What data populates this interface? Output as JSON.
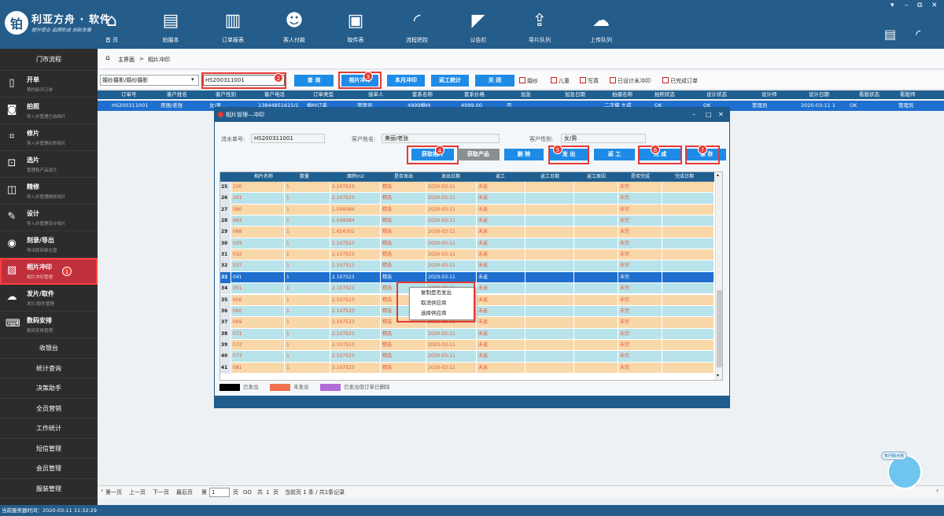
{
  "app": {
    "logo_glyph": "铂",
    "title": "利亚方舟 · 软件",
    "subtitle": "提升营业 品牌形成 创新发展",
    "server_time": "当前服务器时间：2020-03-11 11:32:29"
  },
  "nav": [
    {
      "label": "首 页",
      "icon": "home-icon"
    },
    {
      "label": "拍摄本",
      "icon": "book-icon"
    },
    {
      "label": "订单报表",
      "icon": "bar-chart-icon"
    },
    {
      "label": "客人付款",
      "icon": "users-icon"
    },
    {
      "label": "取件表",
      "icon": "clipboard-icon"
    },
    {
      "label": "流程把控",
      "icon": "signal-icon"
    },
    {
      "label": "公告栏",
      "icon": "megaphone-icon"
    },
    {
      "label": "导片队列",
      "icon": "upload-box-icon"
    },
    {
      "label": "上传队列",
      "icon": "cloud-upload-icon"
    }
  ],
  "sidebar": {
    "header": "门市流程",
    "items": [
      {
        "title": "开单",
        "sub": "预约新开订单",
        "icon": "document-icon"
      },
      {
        "title": "拍照",
        "sub": "导入并管理已拍相片",
        "icon": "camera-icon"
      },
      {
        "title": "修片",
        "sub": "导入并管理初修相片",
        "icon": "crop-icon"
      },
      {
        "title": "选片",
        "sub": "管理和产品选片",
        "icon": "select-icon"
      },
      {
        "title": "精修",
        "sub": "导入并管理精修相片",
        "icon": "retouch-icon"
      },
      {
        "title": "设计",
        "sub": "导入并管理设计相片",
        "icon": "brush-icon"
      },
      {
        "title": "刻录/导出",
        "sub": "导出和刻录光盘",
        "icon": "disc-icon"
      },
      {
        "title": "相片冲印",
        "sub": "相片冲印管理",
        "icon": "photo-icon"
      },
      {
        "title": "发片/取件",
        "sub": "发片/取件管理",
        "icon": "cloud-icon"
      },
      {
        "title": "数码安排",
        "sub": "数码安排管理",
        "icon": "keyboard-icon"
      }
    ],
    "simple": [
      "收银台",
      "统计查询",
      "决策助手",
      "全员营销",
      "工作统计",
      "短信管理",
      "会员管理",
      "服装管理"
    ]
  },
  "breadcrumb": {
    "home": "主界面",
    "sep": ">",
    "current": "相片冲印"
  },
  "toolbar": {
    "filter_value": "婚纱摄影/婚纱摄影",
    "search_value": "HS200311001",
    "query": "查 询",
    "photo_print": "相片冲印",
    "month_print": "本月冲印",
    "rework_stat": "返工统计",
    "close": "关 闭",
    "checks": [
      "婚纱",
      "儿童",
      "写真",
      "已设计未冲印",
      "已完成订单"
    ]
  },
  "badges": [
    "1",
    "2",
    "3",
    "4",
    "5",
    "6",
    "7"
  ],
  "main_table": {
    "headers": [
      "订单号",
      "客户姓名",
      "客户性别",
      "客户电话",
      "订单类型",
      "接单人",
      "套系名称",
      "套系价格",
      "加急",
      "加急日期",
      "拍摄名称",
      "拍照状态",
      "设计状态",
      "设计师",
      "设计日期",
      "看版状态",
      "看版师"
    ],
    "row": [
      "HS200311001",
      "美丽/老张",
      "女/男",
      "13844851615/1",
      "婚纱订单",
      "管理员",
      "4999婚纱",
      "4999.00",
      "否",
      "",
      "二次摄 大成",
      "OK",
      "OK",
      "管理员",
      "2020-03-11 1",
      "OK",
      "管理员"
    ]
  },
  "pager": {
    "first": "第一页",
    "prev": "上一页",
    "next": "下一页",
    "last": "最后页",
    "page_pre": "第",
    "page_value": "1",
    "page_mid": "页",
    "go": "GO",
    "total_pre": "共",
    "total_pages": "1",
    "total_suf": "页",
    "info": "当前页 1 条 / 共1条记录"
  },
  "dialog": {
    "title": "相片管理—冲印",
    "serial_label": "流水单号:",
    "serial_value": "HS200311001",
    "name_label": "客户姓名:",
    "name_value": "美丽/老张",
    "gender_label": "客户性别:",
    "gender_value": "女/男",
    "buttons": {
      "get_photos": "获取相片",
      "get_products": "获取产品",
      "delete": "删 除",
      "send": "发 出",
      "rework": "返 工",
      "complete": "完 成",
      "save": "保 存"
    },
    "grid_headers": [
      "相片名称",
      "数量",
      "面积m2",
      "是否发出",
      "发出日期",
      "返工",
      "返工日期",
      "返工原因",
      "是否完成",
      "完成日期"
    ],
    "rows": [
      {
        "idx": "25",
        "name": "100",
        "qty": "1",
        "area": "2.107523",
        "sent": "精选",
        "date": "2020-03-11",
        "rework": "未返",
        "done": "未完"
      },
      {
        "idx": "26",
        "name": "101",
        "qty": "1",
        "area": "2.107523",
        "sent": "精选",
        "date": "2020-03-11",
        "rework": "未返",
        "done": "未完"
      },
      {
        "idx": "27",
        "name": "080",
        "qty": "1",
        "area": "1.549384",
        "sent": "精选",
        "date": "2020-03-11",
        "rework": "未返",
        "done": "未完"
      },
      {
        "idx": "28",
        "name": "063",
        "qty": "1",
        "area": "1.549384",
        "sent": "精选",
        "date": "2020-03-11",
        "rework": "未返",
        "done": "未完"
      },
      {
        "idx": "29",
        "name": "068",
        "qty": "1",
        "area": "1.654302",
        "sent": "精选",
        "date": "2020-03-11",
        "rework": "未返",
        "done": "未完"
      },
      {
        "idx": "30",
        "name": "029",
        "qty": "1",
        "area": "2.107523",
        "sent": "精选",
        "date": "2020-03-11",
        "rework": "未返",
        "done": "未完"
      },
      {
        "idx": "31",
        "name": "032",
        "qty": "1",
        "area": "2.107523",
        "sent": "精选",
        "date": "2020-03-11",
        "rework": "未返",
        "done": "未完"
      },
      {
        "idx": "32",
        "name": "037",
        "qty": "1",
        "area": "2.107523",
        "sent": "精选",
        "date": "2020-03-11",
        "rework": "未返",
        "done": "未完"
      },
      {
        "idx": "33",
        "name": "041",
        "qty": "1",
        "area": "2.107523",
        "sent": "精选",
        "date": "2020-03-11",
        "rework": "未返",
        "done": "未完"
      },
      {
        "idx": "34",
        "name": "051",
        "qty": "1",
        "area": "2.107523",
        "sent": "精选",
        "date": "2020-03-11",
        "rework": "未返",
        "done": "未完"
      },
      {
        "idx": "35",
        "name": "056",
        "qty": "1",
        "area": "2.107523",
        "sent": "精选",
        "date": "2020-03-11",
        "rework": "未返",
        "done": "未完"
      },
      {
        "idx": "36",
        "name": "060",
        "qty": "1",
        "area": "2.107523",
        "sent": "精选",
        "date": "2020-03-11",
        "rework": "未返",
        "done": "未完"
      },
      {
        "idx": "37",
        "name": "069",
        "qty": "1",
        "area": "2.107523",
        "sent": "精选",
        "date": "2020-03-11",
        "rework": "未返",
        "done": "未完"
      },
      {
        "idx": "38",
        "name": "071",
        "qty": "1",
        "area": "2.107523",
        "sent": "精选",
        "date": "2020-03-11",
        "rework": "未返",
        "done": "未完"
      },
      {
        "idx": "39",
        "name": "072",
        "qty": "1",
        "area": "2.107523",
        "sent": "精选",
        "date": "2020-03-11",
        "rework": "未返",
        "done": "未完"
      },
      {
        "idx": "40",
        "name": "073",
        "qty": "1",
        "area": "2.107523",
        "sent": "精选",
        "date": "2020-03-11",
        "rework": "未返",
        "done": "未完"
      },
      {
        "idx": "41",
        "name": "081",
        "qty": "1",
        "area": "2.107523",
        "sent": "精选",
        "date": "2020-03-11",
        "rework": "未返",
        "done": "未完"
      }
    ],
    "selected_index": 8,
    "context_menu": [
      "复制是否发出",
      "取消供应商",
      "选择供应商"
    ],
    "legend": [
      {
        "label": "已发出",
        "color": "#000000"
      },
      {
        "label": "未发出",
        "color": "#f07050"
      },
      {
        "label": "已发出但订单已删除",
        "color": "#b36bd6"
      }
    ]
  },
  "mascot_label": "有问题点我",
  "colors": {
    "topbar": "#245c8a",
    "sidebar": "#2c2c2c",
    "accent": "#1e8be6",
    "highlight": "#e53935"
  }
}
